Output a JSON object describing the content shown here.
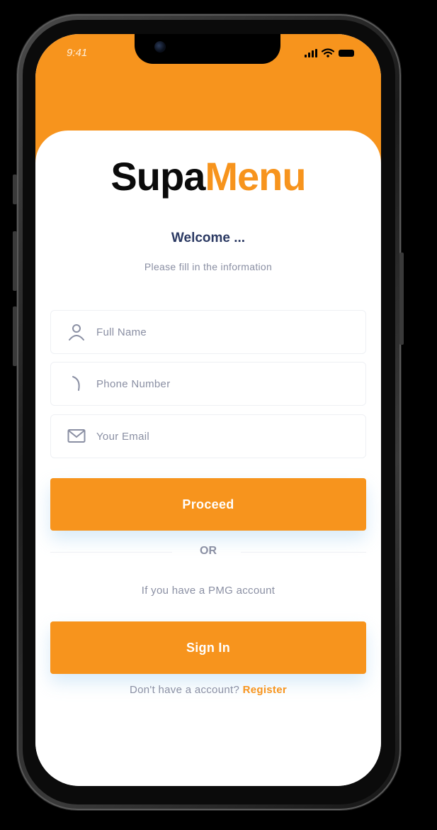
{
  "status_bar": {
    "time": "9:41"
  },
  "brand": {
    "part1": "Supa",
    "part2": "Menu"
  },
  "welcome": {
    "title": "Welcome ...",
    "subtitle": "Please fill in the information"
  },
  "form": {
    "full_name_placeholder": "Full Name",
    "phone_placeholder": "Phone Number",
    "email_placeholder": "Your Email"
  },
  "buttons": {
    "proceed": "Proceed",
    "signin": "Sign In"
  },
  "divider": {
    "or": "OR"
  },
  "pmg_text": "If you have a PMG account",
  "register": {
    "prompt": "Don't have a account?",
    "link": "Register"
  },
  "icons": {
    "user": "user-icon",
    "phone": "phone-icon",
    "email": "envelope-icon",
    "wifi": "wifi-icon",
    "signal": "signal-icon",
    "battery": "battery-icon"
  },
  "colors": {
    "accent": "#f7941d",
    "title": "#2c3a63",
    "muted": "#8a8fa3",
    "logo_dark": "#0b0b0b"
  }
}
